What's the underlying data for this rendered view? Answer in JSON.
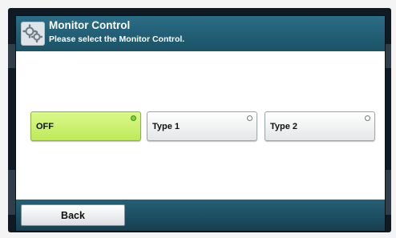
{
  "header": {
    "title": "Monitor Control",
    "subtitle": "Please select the Monitor Control.",
    "icon": "gears-icon"
  },
  "options": [
    {
      "label": "OFF",
      "selected": true
    },
    {
      "label": "Type 1",
      "selected": false
    },
    {
      "label": "Type 2",
      "selected": false
    }
  ],
  "footer": {
    "back_label": "Back"
  },
  "colors": {
    "header_bg": "#1f5a70",
    "selected_bg": "#c8f06a",
    "content_bg": "#ffffff"
  }
}
